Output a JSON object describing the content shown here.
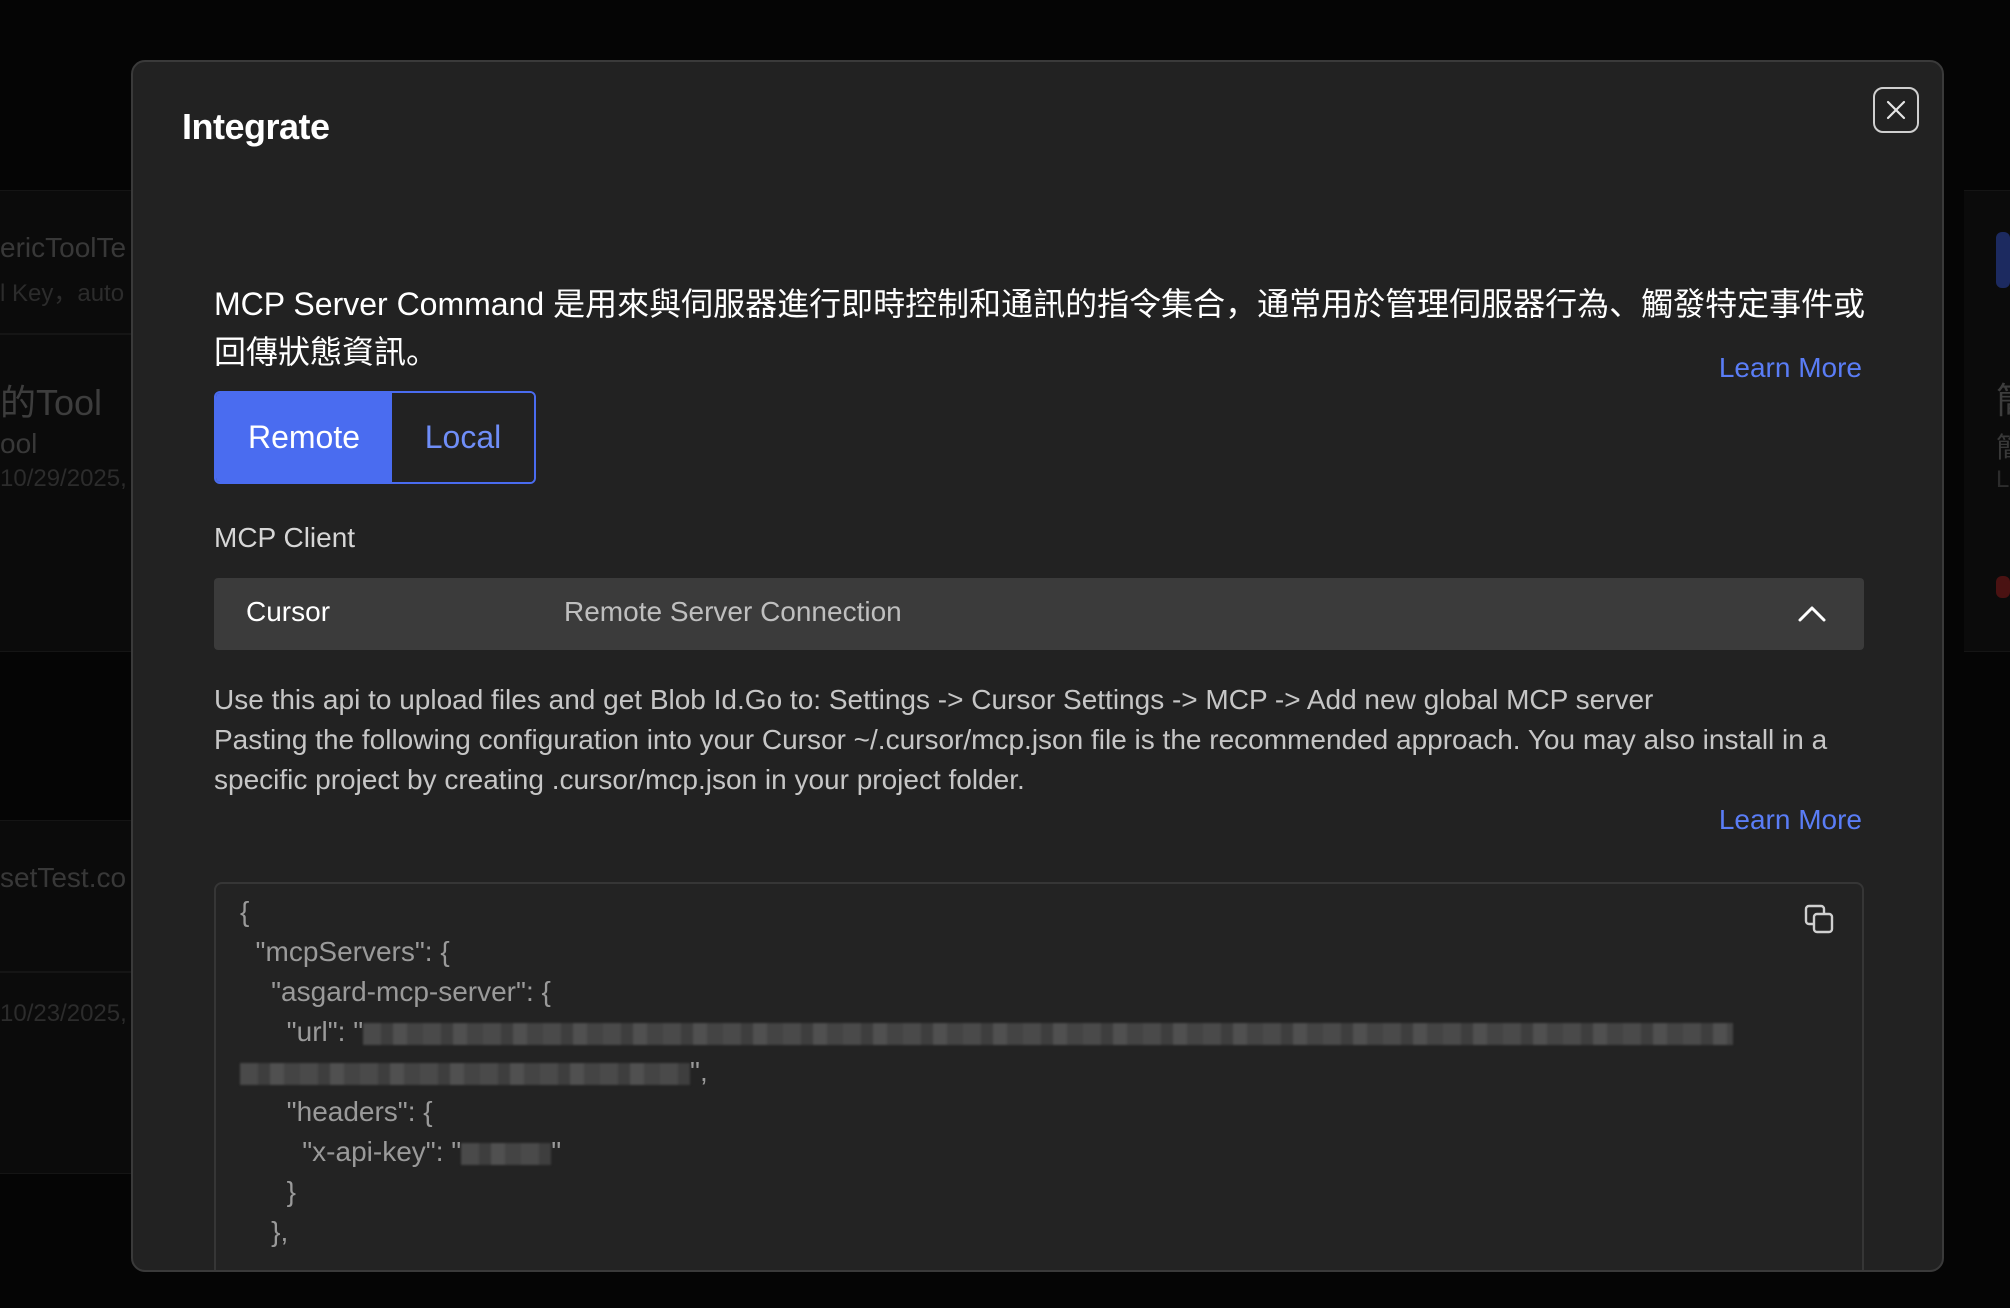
{
  "background": {
    "items": [
      {
        "text": "ericToolTe",
        "size": "mid"
      },
      {
        "text": "l Key，auto",
        "size": "sm"
      },
      {
        "text": "的Tool",
        "size": "big"
      },
      {
        "text": "ool",
        "size": "mid"
      },
      {
        "text": "10/29/2025, ",
        "size": "sm"
      },
      {
        "text": "setTest.co",
        "size": "mid"
      },
      {
        "text": "10/23/2025, ",
        "size": "sm"
      },
      {
        "text": "簡",
        "size": "big"
      },
      {
        "text": "簡",
        "size": "mid"
      },
      {
        "text": "L",
        "size": "sm"
      }
    ]
  },
  "modal": {
    "title": "Integrate",
    "close_icon": "close-icon",
    "description": "MCP Server Command 是用來與伺服器進行即時控制和通訊的指令集合，通常用於管理伺服器行為、觸發特定事件或回傳狀態資訊。",
    "learn_more_top": "Learn More",
    "tabs": {
      "remote": "Remote",
      "local": "Local",
      "selected": "Remote"
    },
    "client_label": "MCP Client",
    "client_select": {
      "value": "Cursor",
      "mode": "Remote Server Connection",
      "icon": "chevron-up-icon"
    },
    "instructions": {
      "line1": "Use this api to upload files and get Blob Id.Go to: Settings -> Cursor Settings -> MCP -> Add new global MCP server",
      "line2": "Pasting the following configuration into your Cursor ~/.cursor/mcp.json file is the recommended approach. You may also install in a",
      "line3": "specific project by creating .cursor/mcp.json in your project folder."
    },
    "learn_more_bottom": "Learn More",
    "code": {
      "copy_icon": "copy-icon",
      "l1": "{",
      "l2": "  \"mcpServers\": {",
      "l3": "    \"asgard-mcp-server\": {",
      "l4": "      \"url\": \"",
      "l5_end": "\",",
      "l6": "      \"headers\": {",
      "l7": "        \"x-api-key\": \"",
      "l7_end": "\"",
      "l8": "      }",
      "l9": "    },"
    }
  },
  "colors": {
    "accent": "#4a6cf0",
    "link": "#5a7df6",
    "modal_bg": "#222222",
    "overlay": "#000000"
  }
}
